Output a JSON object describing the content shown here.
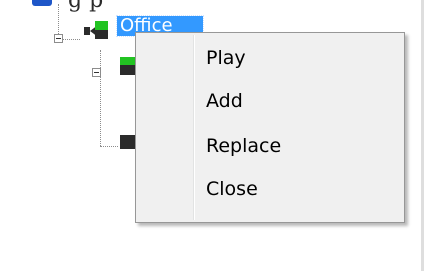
{
  "tree": {
    "root_label_fragment": "g p",
    "selected_node_label": "Office",
    "icons": {
      "camera_active": "camera-green-icon",
      "camera_inactive": "camera-dark-icon",
      "expander": "minus-box-icon"
    }
  },
  "context_menu": {
    "items": [
      {
        "label": "Play"
      },
      {
        "label": "Add"
      },
      {
        "label": "Replace"
      },
      {
        "label": "Close"
      }
    ]
  },
  "colors": {
    "selection": "#3399ff",
    "menu_background": "#f0f0f0",
    "menu_border": "#979797",
    "camera_green": "#22c322",
    "camera_dark": "#2b2b2b"
  }
}
